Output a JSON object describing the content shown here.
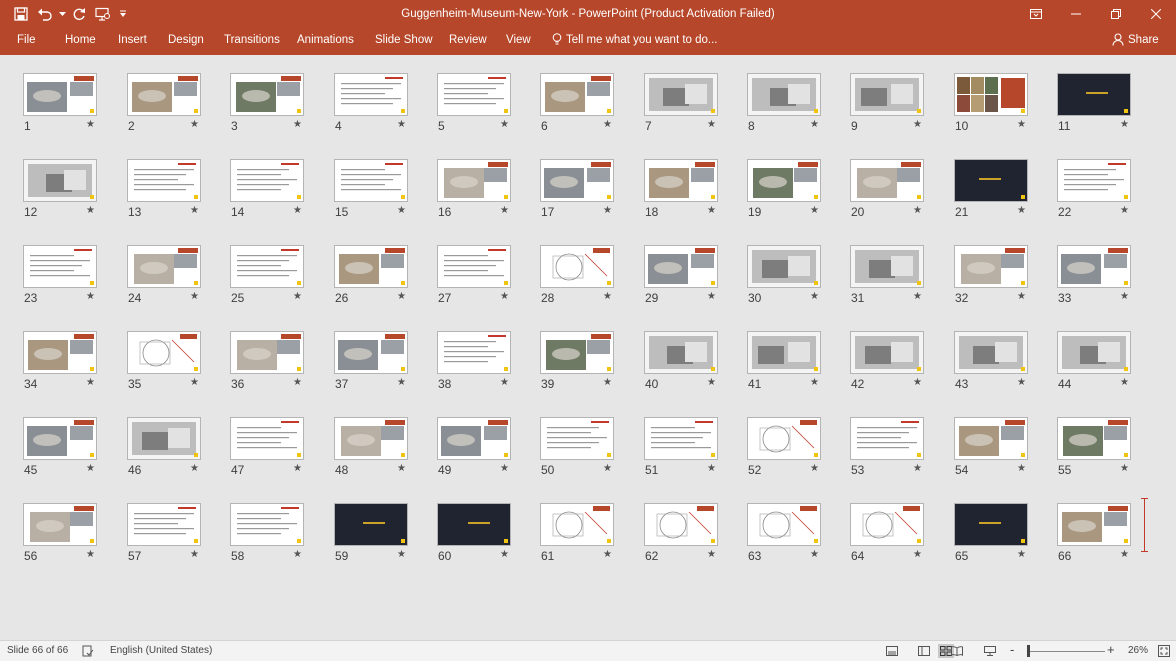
{
  "window": {
    "title": "Guggenheim-Museum-New-York - PowerPoint (Product Activation Failed)"
  },
  "quick_access": {
    "save_icon": "save-icon",
    "undo_icon": "undo-icon",
    "redo_icon": "redo-icon",
    "customize_icon": "customize-qat-icon"
  },
  "ribbon": {
    "tabs": [
      "File",
      "Home",
      "Insert",
      "Design",
      "Transitions",
      "Animations",
      "Slide Show",
      "Review",
      "View"
    ],
    "tell_me": "Tell me what you want to do...",
    "share": "Share"
  },
  "slide_sorter": {
    "slides": [
      {
        "number": "1",
        "style": "photo"
      },
      {
        "number": "2",
        "style": "photo"
      },
      {
        "number": "3",
        "style": "photo"
      },
      {
        "number": "4",
        "style": "text"
      },
      {
        "number": "5",
        "style": "text"
      },
      {
        "number": "6",
        "style": "photo"
      },
      {
        "number": "7",
        "style": "bw"
      },
      {
        "number": "8",
        "style": "bw"
      },
      {
        "number": "9",
        "style": "bw"
      },
      {
        "number": "10",
        "style": "collage"
      },
      {
        "number": "11",
        "style": "dark"
      },
      {
        "number": "12",
        "style": "bw"
      },
      {
        "number": "13",
        "style": "text"
      },
      {
        "number": "14",
        "style": "text"
      },
      {
        "number": "15",
        "style": "text"
      },
      {
        "number": "16",
        "style": "photo"
      },
      {
        "number": "17",
        "style": "photo"
      },
      {
        "number": "18",
        "style": "photo"
      },
      {
        "number": "19",
        "style": "photo"
      },
      {
        "number": "20",
        "style": "photo"
      },
      {
        "number": "21",
        "style": "dark"
      },
      {
        "number": "22",
        "style": "text"
      },
      {
        "number": "23",
        "style": "text"
      },
      {
        "number": "24",
        "style": "photo"
      },
      {
        "number": "25",
        "style": "text"
      },
      {
        "number": "26",
        "style": "photo"
      },
      {
        "number": "27",
        "style": "text"
      },
      {
        "number": "28",
        "style": "sketch"
      },
      {
        "number": "29",
        "style": "photo"
      },
      {
        "number": "30",
        "style": "bw"
      },
      {
        "number": "31",
        "style": "bw"
      },
      {
        "number": "32",
        "style": "photo"
      },
      {
        "number": "33",
        "style": "photo"
      },
      {
        "number": "34",
        "style": "photo"
      },
      {
        "number": "35",
        "style": "sketch"
      },
      {
        "number": "36",
        "style": "photo"
      },
      {
        "number": "37",
        "style": "photo"
      },
      {
        "number": "38",
        "style": "text"
      },
      {
        "number": "39",
        "style": "photo"
      },
      {
        "number": "40",
        "style": "bw"
      },
      {
        "number": "41",
        "style": "bw"
      },
      {
        "number": "42",
        "style": "bw"
      },
      {
        "number": "43",
        "style": "bw"
      },
      {
        "number": "44",
        "style": "bw"
      },
      {
        "number": "45",
        "style": "photo"
      },
      {
        "number": "46",
        "style": "bw"
      },
      {
        "number": "47",
        "style": "text"
      },
      {
        "number": "48",
        "style": "photo"
      },
      {
        "number": "49",
        "style": "photo"
      },
      {
        "number": "50",
        "style": "text"
      },
      {
        "number": "51",
        "style": "text"
      },
      {
        "number": "52",
        "style": "sketch"
      },
      {
        "number": "53",
        "style": "text"
      },
      {
        "number": "54",
        "style": "photo"
      },
      {
        "number": "55",
        "style": "photo"
      },
      {
        "number": "56",
        "style": "photo"
      },
      {
        "number": "57",
        "style": "text"
      },
      {
        "number": "58",
        "style": "text"
      },
      {
        "number": "59",
        "style": "dark"
      },
      {
        "number": "60",
        "style": "dark"
      },
      {
        "number": "61",
        "style": "sketch"
      },
      {
        "number": "62",
        "style": "sketch"
      },
      {
        "number": "63",
        "style": "sketch"
      },
      {
        "number": "64",
        "style": "sketch"
      },
      {
        "number": "65",
        "style": "dark"
      },
      {
        "number": "66",
        "style": "photo"
      }
    ],
    "transition_mark": "★"
  },
  "status_bar": {
    "slide_info": "Slide 66 of 66",
    "language": "English (United States)",
    "zoom_out": "-",
    "zoom_in": "+",
    "zoom_level": "26%",
    "zoom_fraction": 0.06
  },
  "colors": {
    "accent": "#b7472a",
    "sorter_bg": "#e6e6e6",
    "status_bg": "#f3f3f3"
  }
}
